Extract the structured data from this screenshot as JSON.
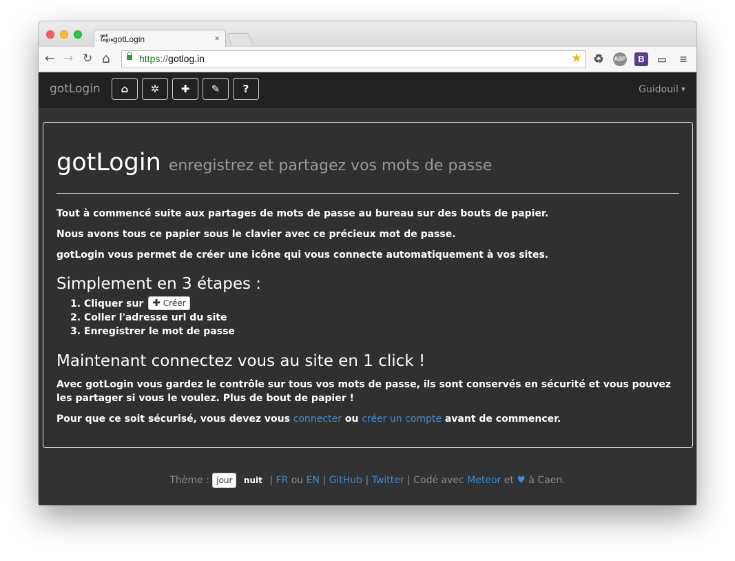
{
  "browser": {
    "tab_title": "gotLogin",
    "tab_close": "×",
    "favicon_text": "got Login",
    "url_scheme": "https",
    "url_sep": "://",
    "url_host": "gotlog.in",
    "back": "←",
    "forward": "→",
    "reload": "↻",
    "home": "⌂",
    "star": "★",
    "ext_abp": "ABP",
    "ext_b": "B",
    "ext_recycle": "♻",
    "ext_cast": "▭",
    "menu": "≡"
  },
  "navbar": {
    "brand": "gotLogin",
    "buttons": [
      {
        "icon": "home-icon",
        "glyph": "⌂"
      },
      {
        "icon": "gear-icon",
        "glyph": "✲"
      },
      {
        "icon": "plus-icon",
        "glyph": "✚"
      },
      {
        "icon": "pencil-icon",
        "glyph": "✎"
      },
      {
        "icon": "question-icon",
        "glyph": "?"
      }
    ],
    "user": "Guidouil",
    "caret": "▼"
  },
  "content": {
    "title": "gotLogin",
    "subtitle": "enregistrez et partagez vos mots de passe",
    "p1": "Tout à commencé suite aux partages de mots de passe au bureau sur des bouts de papier.",
    "p2": "Nous avons tous ce papier sous le clavier avec ce précieux mot de passe.",
    "p3": "gotLogin vous permet de créer une icône qui vous connecte automatiquement à vos sites.",
    "steps_title": "Simplement en 3 étapes :",
    "step1_text": "Cliquer sur",
    "step1_button_plus": "✚",
    "step1_button": "Créer",
    "step2": "Coller l'adresse url du site",
    "step3": "Enregistrer le mot de passe",
    "now_title": "Maintenant connectez vous au site en 1 click !",
    "p4": "Avec gotLogin vous gardez le contrôle sur tous vos mots de passe, ils sont conservés en sécurité et vous pouvez les partager si vous le voulez. Plus de bout de papier !",
    "p5_before": "Pour que ce soit sécurisé, vous devez vous",
    "p5_link1": "connecter",
    "p5_mid": "ou",
    "p5_link2": "créer un compte",
    "p5_after": "avant de commencer."
  },
  "footer": {
    "theme_label": "Thème :",
    "jour": "jour",
    "nuit": "nuit",
    "sep1": "|",
    "fr": "FR",
    "ou": "ou",
    "en": "EN",
    "sep2": "|",
    "github": "GitHub",
    "sep3": "|",
    "twitter": "Twitter",
    "sep4": "|",
    "code_avec": "Codé avec",
    "meteor": "Meteor",
    "et": "et",
    "heart": "♥",
    "a_caen": "à Caen."
  },
  "colors": {
    "background": "#323232",
    "navbar": "#222222",
    "link": "#3a8fd8"
  }
}
